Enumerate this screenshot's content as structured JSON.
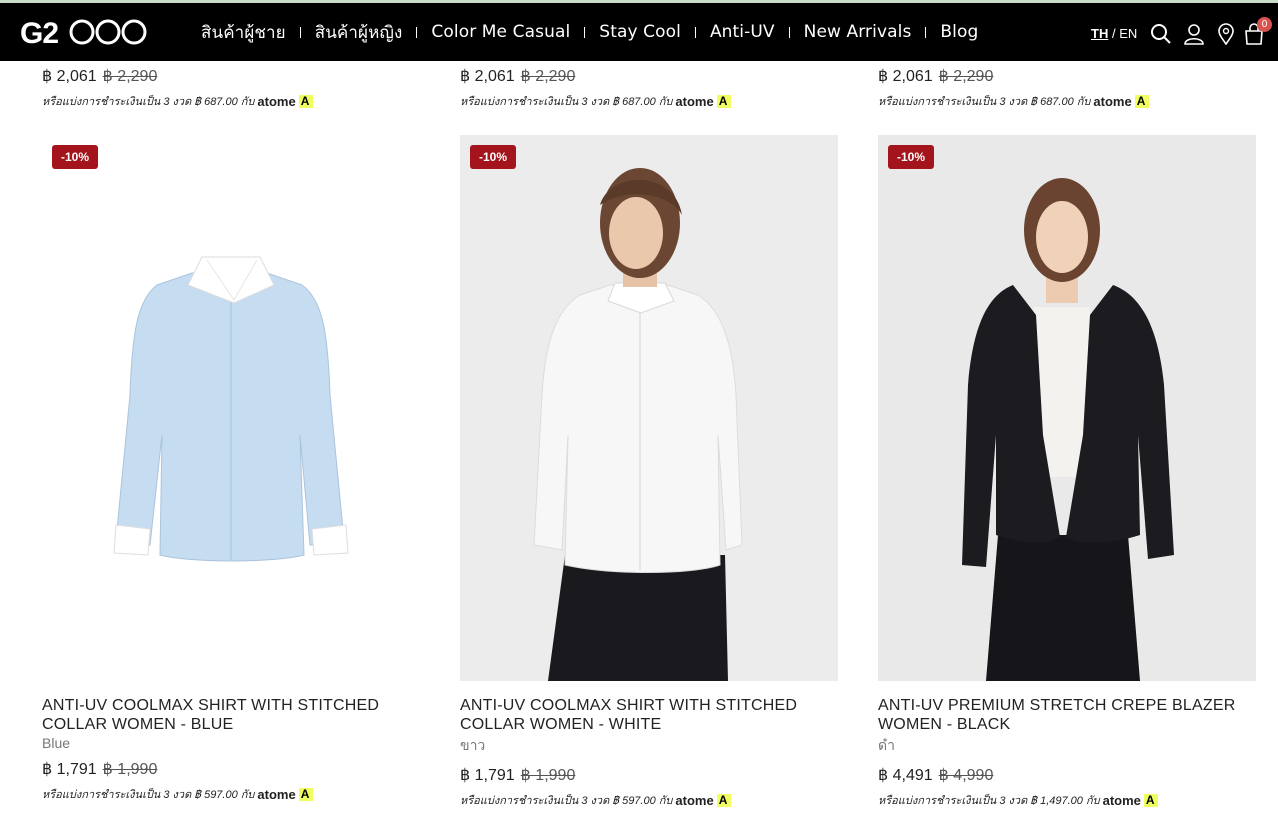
{
  "header": {
    "logo_text": "G2000",
    "menu": [
      "สินค้าผู้ชาย",
      "สินค้าผู้หญิง",
      "Color Me Casual",
      "Stay Cool",
      "Anti-UV",
      "New Arrivals",
      "Blog"
    ],
    "lang_th": "TH",
    "lang_sep": " / ",
    "lang_en": "EN",
    "cart_count": "0",
    "icons": [
      "search-icon",
      "account-icon",
      "store-locator-icon",
      "cart-icon"
    ]
  },
  "previous_row": [
    {
      "price": "฿ 2,061",
      "old_price": "฿ 2,290",
      "installment": "หรือแบ่งการชำระเงินเป็น 3 งวด ฿ 687.00 กับ",
      "brand": "atome"
    },
    {
      "price": "฿ 2,061",
      "old_price": "฿ 2,290",
      "installment": "หรือแบ่งการชำระเงินเป็น 3 งวด ฿ 687.00 กับ",
      "brand": "atome"
    },
    {
      "price": "฿ 2,061",
      "old_price": "฿ 2,290",
      "installment": "หรือแบ่งการชำระเงินเป็น 3 งวด ฿ 687.00 กับ",
      "brand": "atome"
    }
  ],
  "products": [
    {
      "discount": "-10%",
      "title": "ANTI-UV COOLMAX SHIRT WITH STITCHED COLLAR WOMEN - BLUE",
      "color": "Blue",
      "price": "฿ 1,791",
      "old_price": "฿ 1,990",
      "installment": "หรือแบ่งการชำระเงินเป็น 3 งวด ฿ 597.00 กับ",
      "brand": "atome"
    },
    {
      "discount": "-10%",
      "title": "ANTI-UV COOLMAX SHIRT WITH STITCHED COLLAR WOMEN - WHITE",
      "color": "ขาว",
      "price": "฿ 1,791",
      "old_price": "฿ 1,990",
      "installment": "หรือแบ่งการชำระเงินเป็น 3 งวด ฿ 597.00 กับ",
      "brand": "atome"
    },
    {
      "discount": "-10%",
      "title": "ANTI-UV PREMIUM STRETCH CREPE BLAZER WOMEN - BLACK",
      "color": "ดำ",
      "price": "฿ 4,491",
      "old_price": "฿ 4,990",
      "installment": "หรือแบ่งการชำระเงินเป็น 3 งวด ฿ 1,497.00 กับ",
      "brand": "atome"
    }
  ],
  "colors": {
    "nav_bg": "#000000",
    "discount_bg": "#a3141c",
    "badge_bg": "#d9534f",
    "atome_yellow": "#f0ff5f"
  }
}
